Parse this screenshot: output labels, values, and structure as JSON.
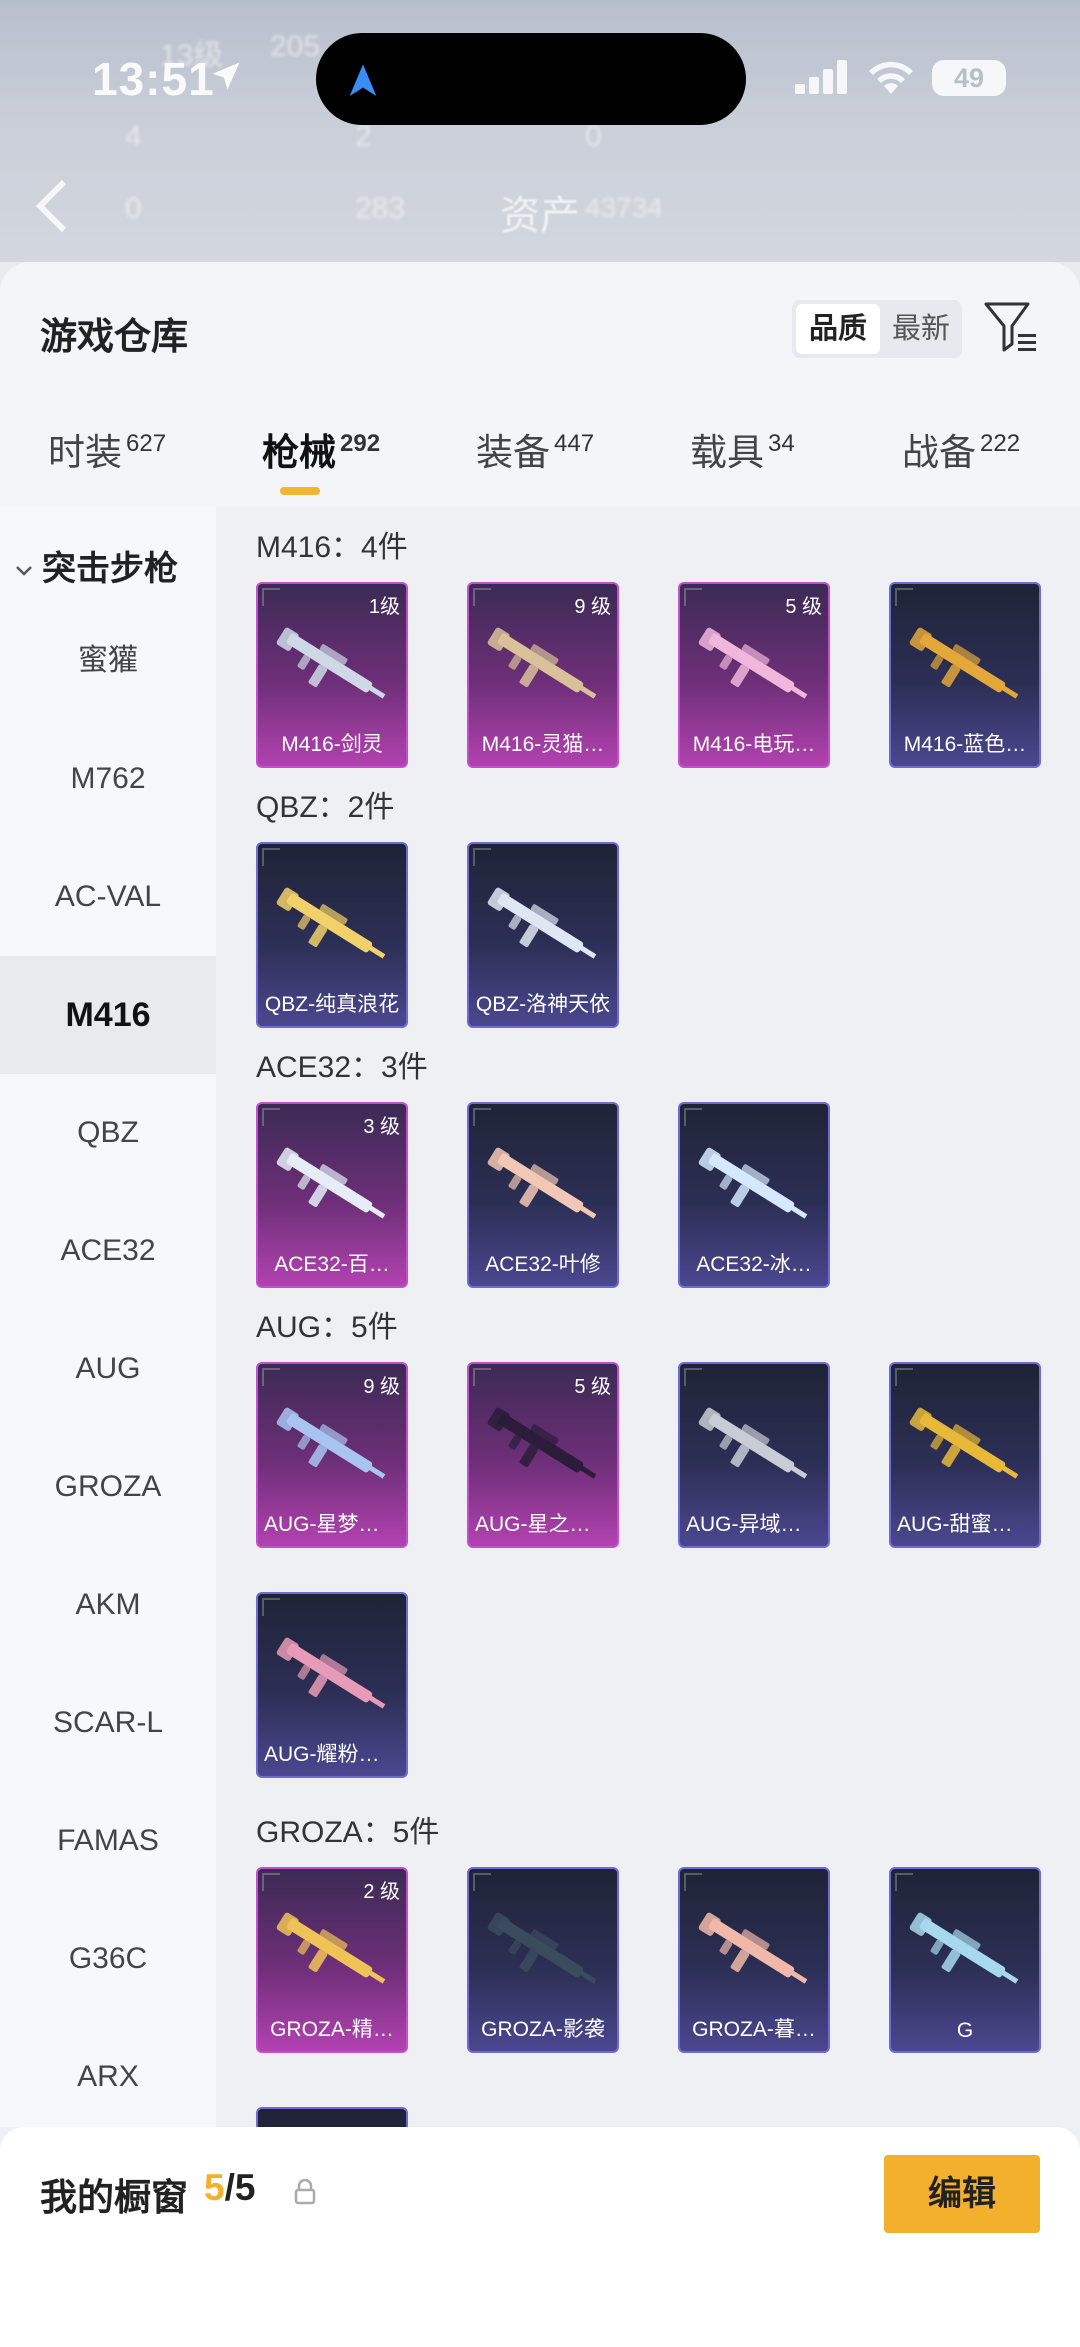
{
  "status": {
    "time": "13:51",
    "battery": "49"
  },
  "background_top": {
    "assets_label": "资产",
    "blur1": "13级",
    "blur2": "205",
    "blur3": "4",
    "blur4": "2",
    "blur5": "0",
    "blur6": "0",
    "blur7": "283",
    "blur8": "43734"
  },
  "header": {
    "title": "游戏仓库",
    "sort_quality": "品质",
    "sort_new": "最新"
  },
  "tabs": [
    {
      "label": "时装",
      "count": "627"
    },
    {
      "label": "枪械",
      "count": "292"
    },
    {
      "label": "装备",
      "count": "447"
    },
    {
      "label": "载具",
      "count": "34"
    },
    {
      "label": "战备",
      "count": "222"
    }
  ],
  "sidebar": {
    "group": "突击步枪",
    "items": [
      "蜜獾",
      "M762",
      "AC-VAL",
      "M416",
      "QBZ",
      "ACE32",
      "AUG",
      "GROZA",
      "AKM",
      "SCAR-L",
      "FAMAS",
      "G36C",
      "ARX"
    ],
    "active": "M416"
  },
  "sections": [
    {
      "title": "M416：4件",
      "items": [
        {
          "name": "M416-剑灵",
          "level": "1级",
          "tier": "purple",
          "gun": "#cfd8e6"
        },
        {
          "name": "M416-灵猫…",
          "level": "9 级",
          "tier": "purple",
          "gun": "#d9c19a"
        },
        {
          "name": "M416-电玩…",
          "level": "5 级",
          "tier": "purple",
          "gun": "#f0b6dc"
        },
        {
          "name": "M416-蓝色…",
          "level": "",
          "tier": "blue",
          "gun": "#e3a73a"
        }
      ]
    },
    {
      "title": "QBZ：2件",
      "items": [
        {
          "name": "QBZ-纯真浪花",
          "level": "",
          "tier": "blue",
          "gun": "#f2d06a"
        },
        {
          "name": "QBZ-洛神天依",
          "level": "",
          "tier": "blue",
          "gun": "#dfe6f4"
        }
      ]
    },
    {
      "title": "ACE32：3件",
      "items": [
        {
          "name": "ACE32-百…",
          "level": "3 级",
          "tier": "purple",
          "gun": "#e6ecf8"
        },
        {
          "name": "ACE32-叶修",
          "level": "",
          "tier": "blue",
          "gun": "#f2c7b5"
        },
        {
          "name": "ACE32-冰…",
          "level": "",
          "tier": "blue",
          "gun": "#d6e8ff"
        }
      ]
    },
    {
      "title": "AUG：5件",
      "items": [
        {
          "name": "AUG-星梦奇缘",
          "level": "9 级",
          "tier": "purple",
          "gun": "#a9c4f0"
        },
        {
          "name": "AUG-星之彼岸",
          "level": "5 级",
          "tier": "purple",
          "gun": "#2a1c3a"
        },
        {
          "name": "AUG-异域银装",
          "level": "",
          "tier": "blue",
          "gun": "#c8ccd6"
        },
        {
          "name": "AUG-甜蜜菠萝",
          "level": "",
          "tier": "blue",
          "gun": "#e8b838"
        },
        {
          "name": "AUG-耀粉歌者",
          "level": "",
          "tier": "blue",
          "gun": "#e89bb8"
        }
      ]
    },
    {
      "title": "GROZA：5件",
      "items": [
        {
          "name": "GROZA-精…",
          "level": "2 级",
          "tier": "purple",
          "gun": "#f0c358"
        },
        {
          "name": "GROZA-影袭",
          "level": "",
          "tier": "blue",
          "gun": "#3b4b5e"
        },
        {
          "name": "GROZA-暮…",
          "level": "",
          "tier": "blue",
          "gun": "#f0b8a8"
        },
        {
          "name": "G",
          "level": "",
          "tier": "blue",
          "gun": "#a8d8ee"
        }
      ]
    }
  ],
  "showcase": {
    "label": "我的橱窗",
    "current": "5",
    "total": "/5",
    "edit": "编辑"
  },
  "colors": {
    "accent": "#f3b02c",
    "purple_tier": "#c34ed0",
    "blue_tier": "#6f6ad6"
  }
}
